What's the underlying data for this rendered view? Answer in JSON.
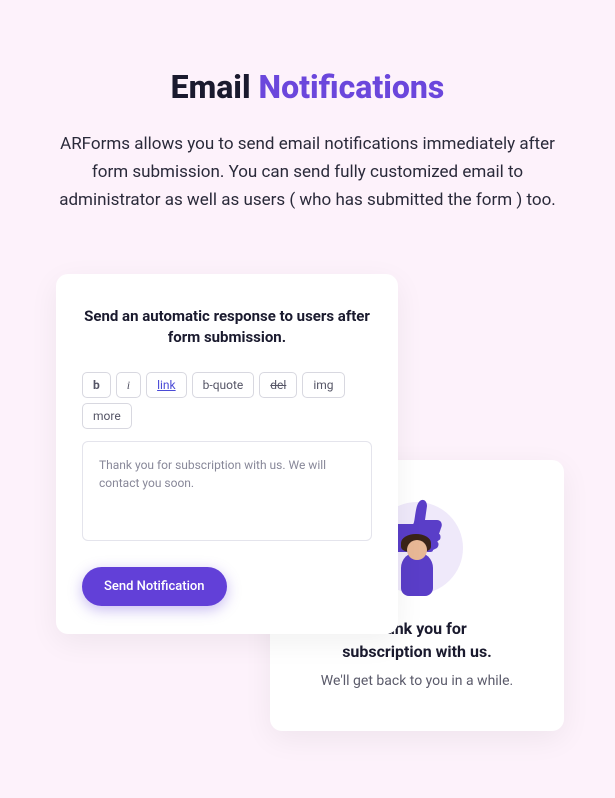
{
  "heading": {
    "part1": "Email ",
    "part2": "Notifications"
  },
  "description": "ARForms allows you to send email notifications immediately after form submission. You can send fully customized email to administrator as well as users ( who has submitted the form ) too.",
  "editor": {
    "title": "Send an automatic response to users after form submission.",
    "toolbar": {
      "bold": "b",
      "italic": "i",
      "link": "link",
      "bquote": "b-quote",
      "del": "del",
      "img": "img",
      "more": "more"
    },
    "textarea_value": "Thank you for subscription with us. We will contact you soon.",
    "send_label": "Send Notification"
  },
  "thanks": {
    "title_line1": "Thank you for",
    "title_line2": "subscription with us.",
    "subtitle": "We'll get back to you in a while."
  }
}
